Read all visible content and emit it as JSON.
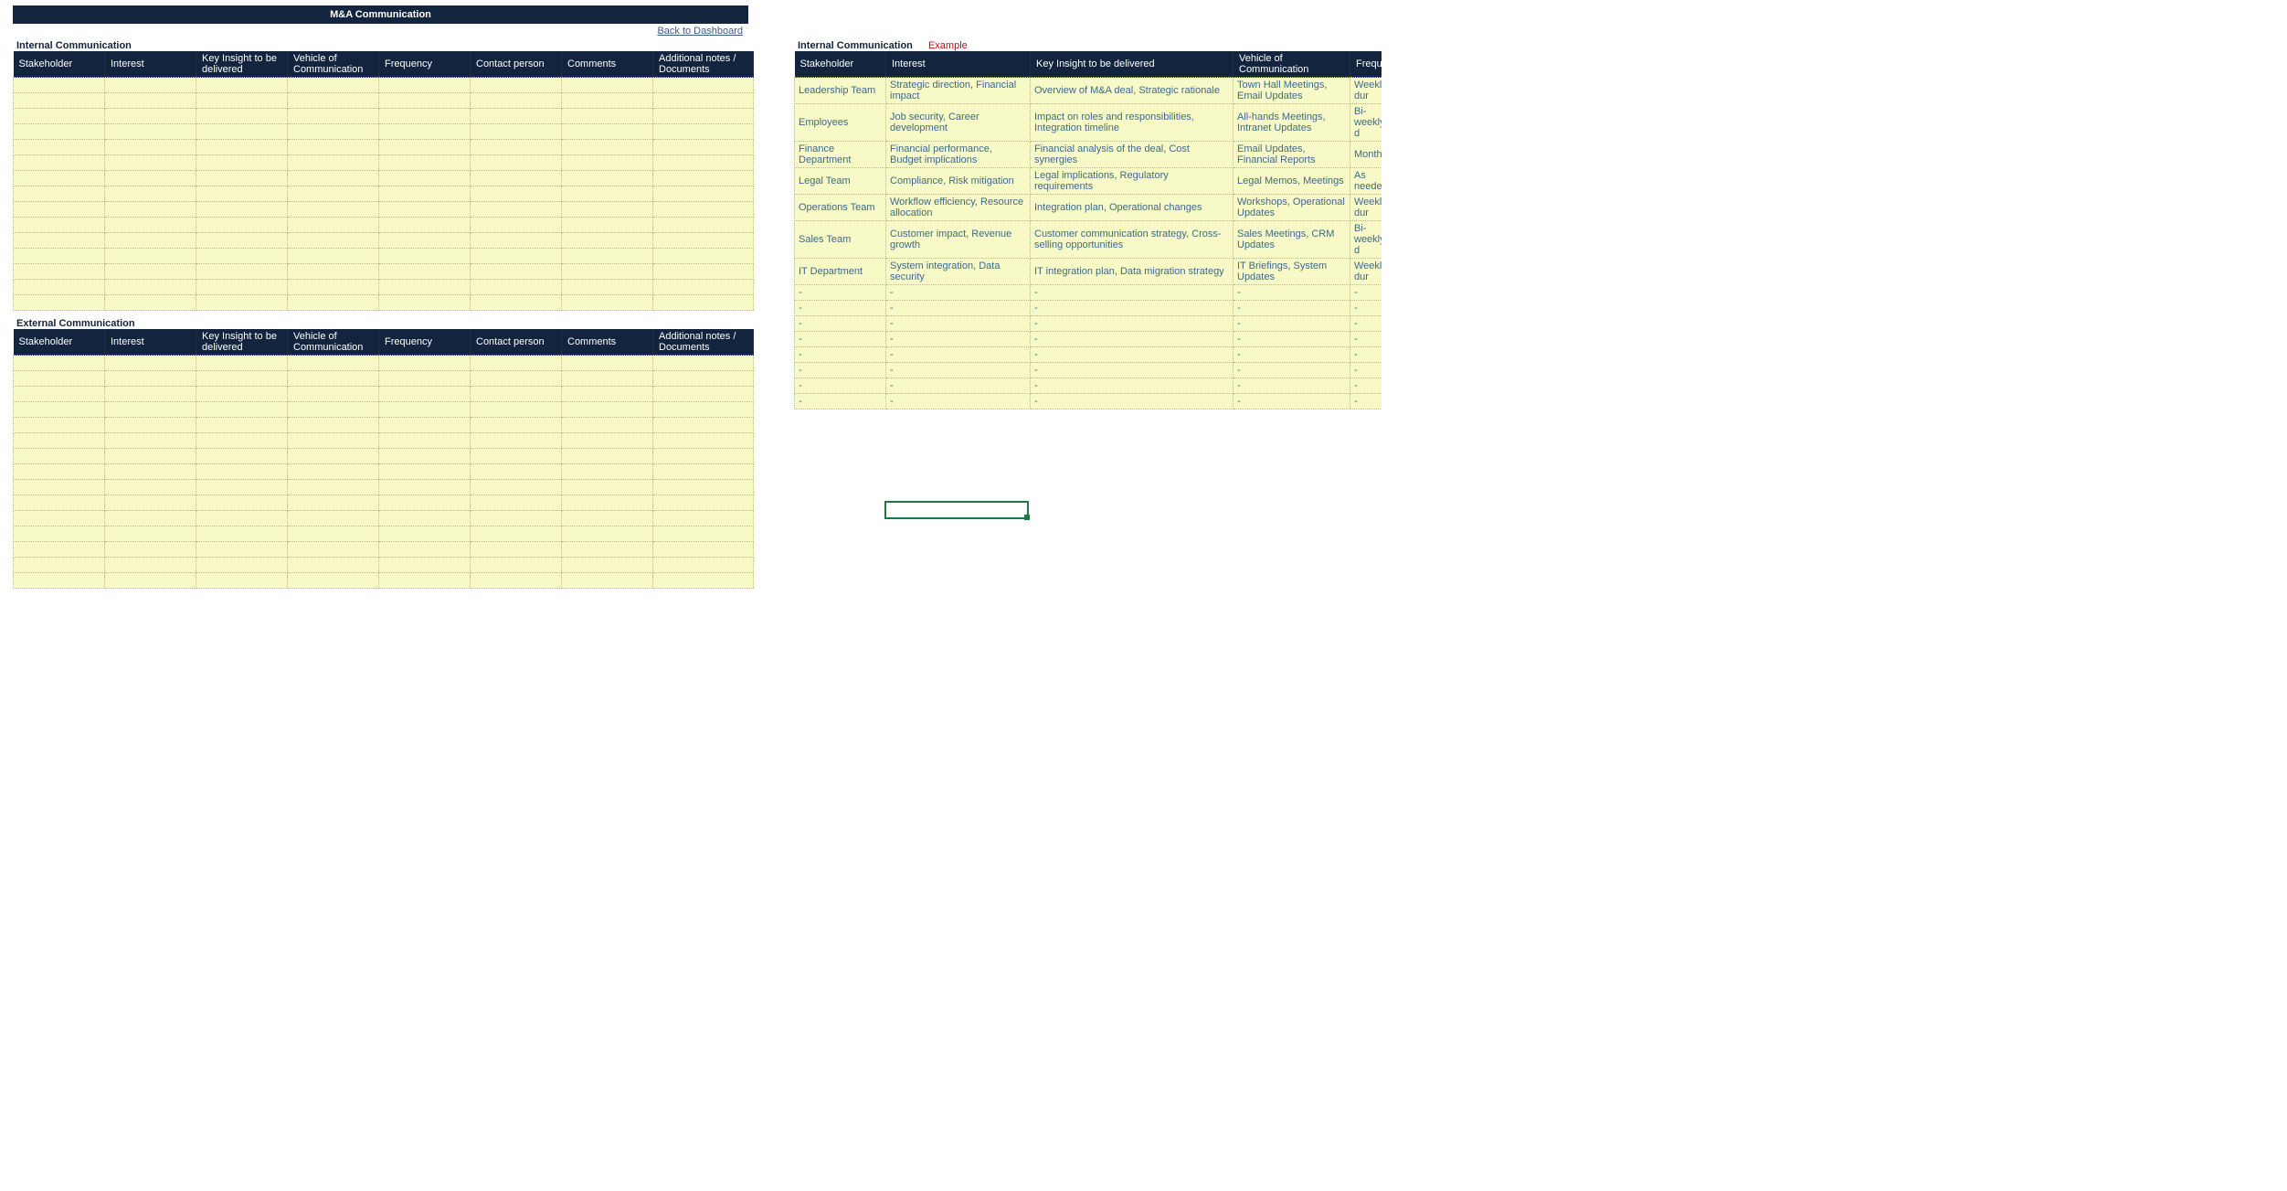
{
  "header": {
    "title": "M&A Communication",
    "back_link": "Back to Dashboard"
  },
  "sections": {
    "internal_title": "Internal Communication",
    "external_title": "External Communication",
    "internal_example_title": "Internal Communication",
    "example_label": "Example"
  },
  "columns_main": [
    "Stakeholder",
    "Interest",
    "Key Insight to be delivered",
    "Vehicle of Communication",
    "Frequency",
    "Contact person",
    "Comments",
    "Additional notes / Documents"
  ],
  "columns_example": [
    "Stakeholder",
    "Interest",
    "Key Insight to be delivered",
    "Vehicle of Communication",
    "Frequency"
  ],
  "internal_rows": [
    [
      "",
      "",
      "",
      "",
      "",
      "",
      "",
      ""
    ],
    [
      "",
      "",
      "",
      "",
      "",
      "",
      "",
      ""
    ],
    [
      "",
      "",
      "",
      "",
      "",
      "",
      "",
      ""
    ],
    [
      "",
      "",
      "",
      "",
      "",
      "",
      "",
      ""
    ],
    [
      "",
      "",
      "",
      "",
      "",
      "",
      "",
      ""
    ],
    [
      "",
      "",
      "",
      "",
      "",
      "",
      "",
      ""
    ],
    [
      "",
      "",
      "",
      "",
      "",
      "",
      "",
      ""
    ],
    [
      "",
      "",
      "",
      "",
      "",
      "",
      "",
      ""
    ],
    [
      "",
      "",
      "",
      "",
      "",
      "",
      "",
      ""
    ],
    [
      "",
      "",
      "",
      "",
      "",
      "",
      "",
      ""
    ],
    [
      "",
      "",
      "",
      "",
      "",
      "",
      "",
      ""
    ],
    [
      "",
      "",
      "",
      "",
      "",
      "",
      "",
      ""
    ],
    [
      "",
      "",
      "",
      "",
      "",
      "",
      "",
      ""
    ],
    [
      "",
      "",
      "",
      "",
      "",
      "",
      "",
      ""
    ],
    [
      "",
      "",
      "",
      "",
      "",
      "",
      "",
      ""
    ]
  ],
  "external_rows": [
    [
      "",
      "",
      "",
      "",
      "",
      "",
      "",
      ""
    ],
    [
      "",
      "",
      "",
      "",
      "",
      "",
      "",
      ""
    ],
    [
      "",
      "",
      "",
      "",
      "",
      "",
      "",
      ""
    ],
    [
      "",
      "",
      "",
      "",
      "",
      "",
      "",
      ""
    ],
    [
      "",
      "",
      "",
      "",
      "",
      "",
      "",
      ""
    ],
    [
      "",
      "",
      "",
      "",
      "",
      "",
      "",
      ""
    ],
    [
      "",
      "",
      "",
      "",
      "",
      "",
      "",
      ""
    ],
    [
      "",
      "",
      "",
      "",
      "",
      "",
      "",
      ""
    ],
    [
      "",
      "",
      "",
      "",
      "",
      "",
      "",
      ""
    ],
    [
      "",
      "",
      "",
      "",
      "",
      "",
      "",
      ""
    ],
    [
      "",
      "",
      "",
      "",
      "",
      "",
      "",
      ""
    ],
    [
      "",
      "",
      "",
      "",
      "",
      "",
      "",
      ""
    ],
    [
      "",
      "",
      "",
      "",
      "",
      "",
      "",
      ""
    ],
    [
      "",
      "",
      "",
      "",
      "",
      "",
      "",
      ""
    ],
    [
      "",
      "",
      "",
      "",
      "",
      "",
      "",
      ""
    ]
  ],
  "example_rows": [
    [
      "Leadership Team",
      "Strategic direction, Financial impact",
      "Overview of M&A deal, Strategic rationale",
      "Town Hall Meetings, Email Updates",
      "Weekly dur"
    ],
    [
      "Employees",
      "Job security, Career development",
      "Impact on roles and responsibilities, Integration timeline",
      "All-hands Meetings, Intranet Updates",
      "Bi-weekly d"
    ],
    [
      "Finance Department",
      "Financial performance, Budget implications",
      "Financial analysis of the deal, Cost synergies",
      "Email Updates, Financial Reports",
      "Monthly"
    ],
    [
      "Legal Team",
      "Compliance, Risk mitigation",
      "Legal implications, Regulatory requirements",
      "Legal Memos, Meetings",
      "As needed"
    ],
    [
      "Operations Team",
      "Workflow efficiency, Resource allocation",
      "Integration plan, Operational changes",
      "Workshops, Operational Updates",
      "Weekly dur"
    ],
    [
      "Sales Team",
      "Customer impact, Revenue growth",
      "Customer communication strategy, Cross-selling opportunities",
      "Sales Meetings, CRM Updates",
      "Bi-weekly d"
    ],
    [
      "IT Department",
      "System integration, Data security",
      "IT integration plan, Data migration strategy",
      "IT Briefings, System Updates",
      "Weekly dur"
    ],
    [
      "-",
      "-",
      "-",
      "-",
      "-"
    ],
    [
      "-",
      "-",
      "-",
      "-",
      "-"
    ],
    [
      "-",
      "-",
      "-",
      "-",
      "-"
    ],
    [
      "-",
      "-",
      "-",
      "-",
      "-"
    ],
    [
      "-",
      "-",
      "-",
      "-",
      "-"
    ],
    [
      "-",
      "-",
      "-",
      "-",
      "-"
    ],
    [
      "-",
      "-",
      "-",
      "-",
      "-"
    ],
    [
      "-",
      "-",
      "-",
      "-",
      "-"
    ]
  ],
  "col_widths_main": [
    100,
    100,
    100,
    100,
    100,
    100,
    100,
    110
  ],
  "col_widths_example": [
    100,
    158,
    222,
    128,
    35
  ]
}
